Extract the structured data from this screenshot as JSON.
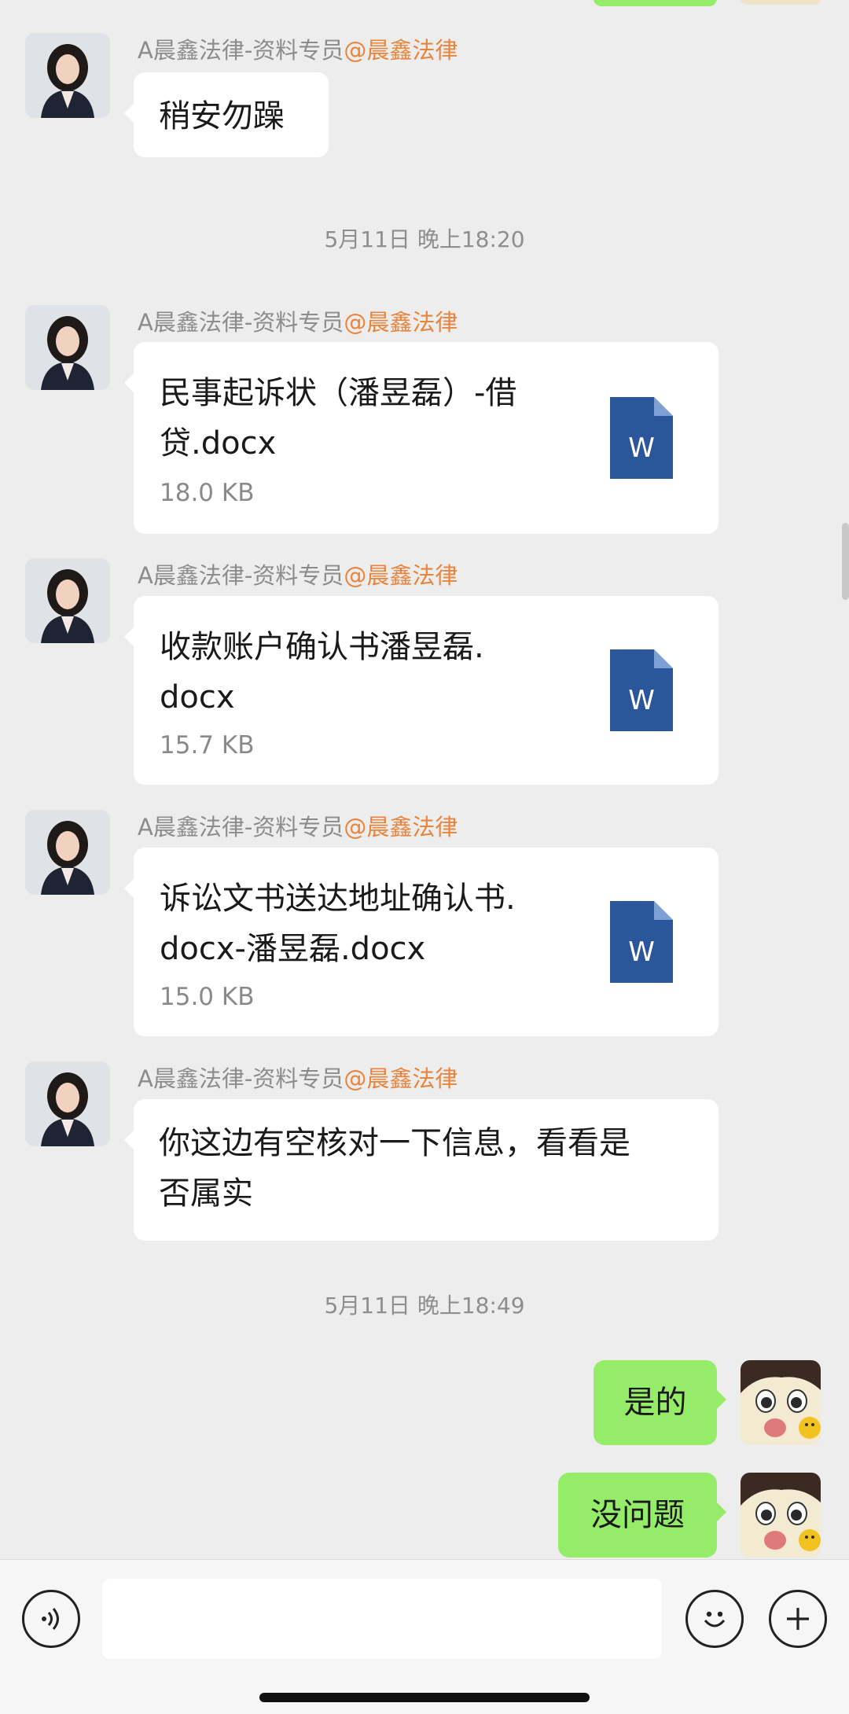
{
  "messages": {
    "m1": {
      "sender": "A晨鑫法律-资料专员",
      "tag": "@晨鑫法律",
      "text": "稍安勿躁"
    },
    "ts1": "5月11日 晚上18:20",
    "f1": {
      "sender": "A晨鑫法律-资料专员",
      "tag": "@晨鑫法律",
      "name_line1": "民事起诉状（潘昱磊）-借",
      "name_line2": "贷.docx",
      "size": "18.0 KB",
      "icon": "W"
    },
    "f2": {
      "sender": "A晨鑫法律-资料专员",
      "tag": "@晨鑫法律",
      "name_line1": "收款账户确认书潘昱磊.",
      "name_line2": "docx",
      "size": "15.7 KB",
      "icon": "W"
    },
    "f3": {
      "sender": "A晨鑫法律-资料专员",
      "tag": "@晨鑫法律",
      "name_line1": "诉讼文书送达地址确认书.",
      "name_line2": "docx-潘昱磊.docx",
      "size": "15.0 KB",
      "icon": "W"
    },
    "m2": {
      "sender": "A晨鑫法律-资料专员",
      "tag": "@晨鑫法律",
      "line1": "你这边有空核对一下信息，看看是",
      "line2": "否属实"
    },
    "ts2": "5月11日 晚上18:49",
    "r1": {
      "text": "是的"
    },
    "r2": {
      "text": "没问题"
    }
  },
  "toolbar": {
    "voice_icon": "voice-icon",
    "emoji_icon": "emoji-icon",
    "plus_icon": "plus-icon",
    "input_value": ""
  },
  "colors": {
    "background": "#ededed",
    "self_bubble": "#95ec69",
    "other_bubble": "#ffffff",
    "tag": "#e8843c",
    "word_icon": "#2b579a"
  }
}
